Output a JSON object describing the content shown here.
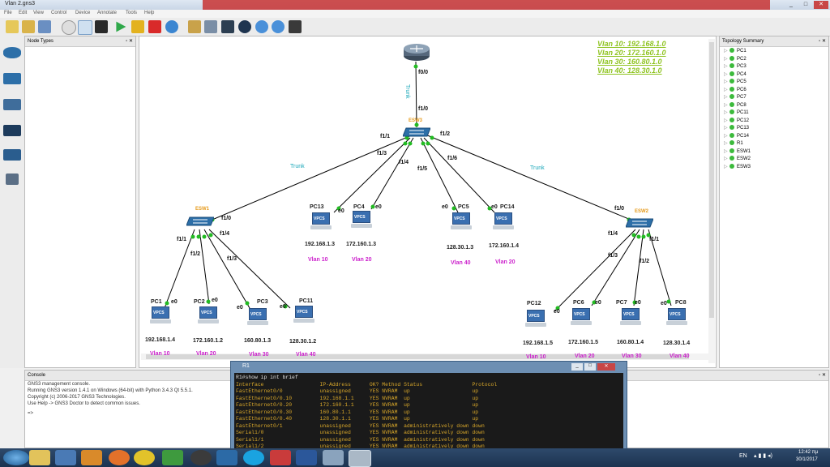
{
  "window": {
    "title": "Vlan 2.gns3",
    "controls": [
      "_",
      "□",
      "✕"
    ]
  },
  "menu": [
    "File",
    "Edit",
    "View",
    "Control",
    "Device",
    "Annotate",
    "Tools",
    "Help"
  ],
  "panels": {
    "node_types": {
      "title": "Node Types"
    },
    "topology_summary": {
      "title": "Topology Summary",
      "items": [
        "PC1",
        "PC2",
        "PC3",
        "PC4",
        "PC5",
        "PC6",
        "PC7",
        "PC8",
        "PC11",
        "PC12",
        "PC13",
        "PC14",
        "R1",
        "ESW1",
        "ESW2",
        "ESW3"
      ]
    },
    "console": {
      "title": "Console",
      "lines": [
        "GNS3 management console.",
        "Running GNS3 version 1.4.1 on Windows (64-bit) with Python 3.4.3 Qt 5.5.1.",
        "Copyright (c) 2006-2017 GNS3 Technologies.",
        "Use Help -> GNS3 Doctor to detect common issues.",
        "",
        "=>"
      ]
    }
  },
  "topology": {
    "legend": [
      "Vlan 10: 192.168.1.0",
      "Vlan 20: 172.160.1.0",
      "Vlan 30: 160.80.1.0",
      "Vlan 40: 128.30.1.0"
    ],
    "router": {
      "port": "f0/0",
      "trunk": "Trunk"
    },
    "esw3": {
      "name": "ESW3",
      "ports": [
        "f1/0",
        "f1/1",
        "f1/2",
        "f1/3",
        "f1/4",
        "f1/5",
        "f1/6"
      ]
    },
    "esw1": {
      "name": "ESW1",
      "ports": [
        "f1/0",
        "f1/1",
        "f1/2",
        "f1/3",
        "f1/4"
      ]
    },
    "esw2": {
      "name": "ESW2",
      "ports": [
        "f1/0",
        "f1/1",
        "f1/2",
        "f1/3",
        "f1/4"
      ]
    },
    "trunk_left": "Trunk",
    "trunk_right": "Trunk",
    "pcs": [
      {
        "name": "PC13",
        "port": "e0",
        "ip": "192.168.1.3",
        "vlan": "Vlan 10"
      },
      {
        "name": "PC4",
        "port": "e0",
        "ip": "172.160.1.3",
        "vlan": "Vlan 20"
      },
      {
        "name": "PC5",
        "port": "e0",
        "ip": "128.30.1.3",
        "vlan": "Vlan 40"
      },
      {
        "name": "PC14",
        "port": "e0",
        "ip": "172.160.1.4",
        "vlan": "Vlan 20"
      },
      {
        "name": "PC1",
        "port": "e0",
        "ip": "192.168.1.4",
        "vlan": "Vlan 10"
      },
      {
        "name": "PC2",
        "port": "e0",
        "ip": "172.160.1.2",
        "vlan": "Vlan 20"
      },
      {
        "name": "PC3",
        "port": "e0",
        "ip": "160.80.1.3",
        "vlan": "Vlan 30"
      },
      {
        "name": "PC11",
        "port": "e0",
        "ip": "128.30.1.2",
        "vlan": "Vlan 40"
      },
      {
        "name": "PC12",
        "port": "e0",
        "ip": "192.168.1.5",
        "vlan": "Vlan 10"
      },
      {
        "name": "PC6",
        "port": "e0",
        "ip": "172.160.1.5",
        "vlan": "Vlan 20"
      },
      {
        "name": "PC7",
        "port": "e0",
        "ip": "160.80.1.4",
        "vlan": "Vlan 30"
      },
      {
        "name": "PC8",
        "port": "e0",
        "ip": "128.30.1.4",
        "vlan": "Vlan 40"
      }
    ],
    "vpcs_label": "VPCS"
  },
  "terminal": {
    "title": "R1",
    "lines": [
      "R1#show ip int brief",
      "Interface                  IP-Address      OK? Method Status                Protocol",
      "FastEthernet0/0            unassigned      YES NVRAM  up                    up",
      "FastEthernet0/0.10         192.168.1.1     YES NVRAM  up                    up",
      "FastEthernet0/0.20         172.160.1.1     YES NVRAM  up                    up",
      "FastEthernet0/0.30         160.80.1.1      YES NVRAM  up                    up",
      "FastEthernet0/0.40         128.30.1.1      YES NVRAM  up                    up",
      "FastEthernet0/1            unassigned      YES NVRAM  administratively down down",
      "Serial1/0                  unassigned      YES NVRAM  administratively down down",
      "Serial1/1                  unassigned      YES NVRAM  administratively down down",
      "Serial1/2                  unassigned      YES NVRAM  administratively down down"
    ]
  },
  "taskbar": {
    "lang": "EN",
    "time": "12:42 πμ",
    "date": "30/1/2017"
  },
  "colors": {
    "link": "#000000",
    "port_dot": "#22bb22",
    "vlan_text": "#cc22cc",
    "trunk_text": "#1aa7b9",
    "legend_text": "#8ec31f",
    "switch_name": "#e69a1a"
  }
}
